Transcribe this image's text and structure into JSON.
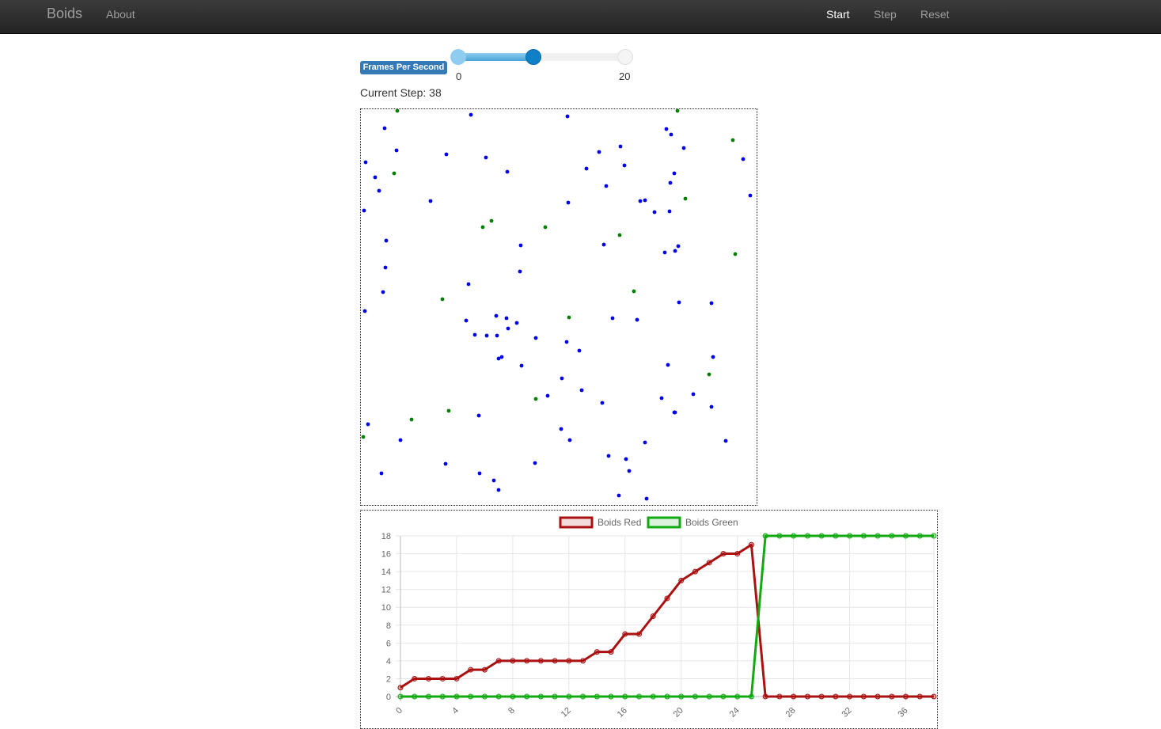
{
  "nav": {
    "brand": "Boids",
    "about": "About",
    "start": "Start",
    "step": "Step",
    "reset": "Reset"
  },
  "controls": {
    "fps_label": "Frames Per Second",
    "slider_min": 0,
    "slider_max": 20,
    "slider_min_label": "0",
    "slider_max_label": "20",
    "slider_value": 9,
    "step_label": "Current Step: ",
    "step_value": "38"
  },
  "simulation": {
    "colors": {
      "blue": "#0000ee",
      "green": "#008000"
    },
    "blue_boids": [
      [
        139,
        7
      ],
      [
        261,
        9
      ],
      [
        45,
        52
      ],
      [
        6,
        67
      ],
      [
        108,
        57
      ],
      [
        158,
        61
      ],
      [
        328,
        47
      ],
      [
        301,
        54
      ],
      [
        18,
        86
      ],
      [
        285,
        75
      ],
      [
        23,
        103
      ],
      [
        185,
        79
      ],
      [
        88,
        116
      ],
      [
        262,
        118
      ],
      [
        310,
        97
      ],
      [
        333,
        71
      ],
      [
        391,
        93
      ],
      [
        30,
        24
      ],
      [
        4,
        128
      ],
      [
        483,
        63
      ],
      [
        390,
        129
      ],
      [
        307,
        171
      ],
      [
        32,
        166
      ],
      [
        31,
        200
      ],
      [
        397,
        179
      ],
      [
        384,
        181
      ],
      [
        371,
        130
      ],
      [
        386,
        25
      ],
      [
        401,
        173
      ],
      [
        408,
        49
      ],
      [
        396,
        81
      ],
      [
        392,
        32
      ],
      [
        359,
        115
      ],
      [
        353,
        116
      ],
      [
        492,
        109
      ],
      [
        443,
        245
      ],
      [
        28,
        231
      ],
      [
        136,
        221
      ],
      [
        5,
        255
      ],
      [
        172,
        286
      ],
      [
        202,
        172
      ],
      [
        201,
        205
      ],
      [
        133,
        267
      ],
      [
        144,
        285
      ],
      [
        159,
        286
      ],
      [
        171,
        261
      ],
      [
        184,
        264
      ],
      [
        197,
        270
      ],
      [
        186,
        277
      ],
      [
        178,
        313
      ],
      [
        221,
        289
      ],
      [
        260,
        294
      ],
      [
        276,
        305
      ],
      [
        254,
        340
      ],
      [
        174,
        315
      ],
      [
        203,
        324
      ],
      [
        236,
        362
      ],
      [
        318,
        264
      ],
      [
        349,
        266
      ],
      [
        388,
        323
      ],
      [
        420,
        360
      ],
      [
        279,
        355
      ],
      [
        396,
        383
      ],
      [
        9,
        398
      ],
      [
        50,
        418
      ],
      [
        149,
        387
      ],
      [
        107,
        448
      ],
      [
        26,
        460
      ],
      [
        150,
        460
      ],
      [
        168,
        469
      ],
      [
        174,
        481
      ],
      [
        220,
        447
      ],
      [
        264,
        418
      ],
      [
        253,
        404
      ],
      [
        305,
        371
      ],
      [
        313,
        438
      ],
      [
        335,
        442
      ],
      [
        339,
        457
      ],
      [
        326,
        488
      ],
      [
        361,
        492
      ],
      [
        380,
        365
      ],
      [
        359,
        421
      ],
      [
        397,
        383
      ],
      [
        445,
        313
      ],
      [
        443,
        376
      ],
      [
        461,
        419
      ],
      [
        402,
        244
      ]
    ],
    "green_boids": [
      [
        46,
        2
      ],
      [
        400,
        2
      ],
      [
        470,
        39
      ],
      [
        42,
        81
      ],
      [
        410,
        113
      ],
      [
        165,
        141
      ],
      [
        154,
        149
      ],
      [
        233,
        149
      ],
      [
        327,
        159
      ],
      [
        473,
        183
      ],
      [
        103,
        240
      ],
      [
        345,
        230
      ],
      [
        263,
        263
      ],
      [
        440,
        335
      ],
      [
        221,
        366
      ],
      [
        111,
        381
      ],
      [
        64,
        392
      ],
      [
        3,
        414
      ]
    ]
  },
  "chart_data": {
    "type": "line",
    "x": [
      0,
      1,
      2,
      3,
      4,
      5,
      6,
      7,
      8,
      9,
      10,
      11,
      12,
      13,
      14,
      15,
      16,
      17,
      18,
      19,
      20,
      21,
      22,
      23,
      24,
      25,
      26,
      27,
      28,
      29,
      30,
      31,
      32,
      33,
      34,
      35,
      36,
      37,
      38
    ],
    "x_tick_labels": [
      "0",
      "4",
      "8",
      "12",
      "16",
      "20",
      "24",
      "28",
      "32",
      "36"
    ],
    "y_tick_labels": [
      "0",
      "2",
      "4",
      "6",
      "8",
      "10",
      "12",
      "14",
      "16",
      "18"
    ],
    "ylim": [
      0,
      18
    ],
    "xlim": [
      0,
      38
    ],
    "grid": true,
    "legend_position": "top",
    "series": [
      {
        "name": "Boids Red",
        "color": "#aa1111",
        "values": [
          1,
          2,
          2,
          2,
          2,
          3,
          3,
          4,
          4,
          4,
          4,
          4,
          4,
          4,
          5,
          5,
          7,
          7,
          9,
          11,
          13,
          14,
          15,
          16,
          16,
          17,
          0,
          0,
          0,
          0,
          0,
          0,
          0,
          0,
          0,
          0,
          0,
          0,
          0
        ]
      },
      {
        "name": "Boids Green",
        "color": "#11aa11",
        "values": [
          0,
          0,
          0,
          0,
          0,
          0,
          0,
          0,
          0,
          0,
          0,
          0,
          0,
          0,
          0,
          0,
          0,
          0,
          0,
          0,
          0,
          0,
          0,
          0,
          0,
          0,
          18,
          18,
          18,
          18,
          18,
          18,
          18,
          18,
          18,
          18,
          18,
          18,
          18
        ]
      }
    ]
  }
}
